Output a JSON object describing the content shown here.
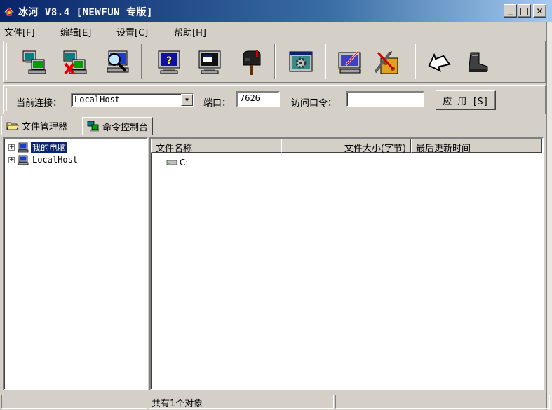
{
  "window": {
    "title": "冰河 V8.4 [NEWFUN 专版]",
    "minimize_symbol": "_",
    "restore_symbol": "□",
    "close_symbol": "✕"
  },
  "menu": {
    "items": [
      "文件[F]",
      "编辑[E]",
      "设置[C]",
      "帮助[H]"
    ]
  },
  "toolbar": {
    "buttons": [
      "add-host-icon",
      "delete-host-icon",
      "search-host-icon",
      "help-monitor-icon",
      "screen-capture-icon",
      "mailbox-icon",
      "gear-window-icon",
      "config-icon",
      "tools-icon",
      "back-arrow-icon",
      "exit-boot-icon"
    ]
  },
  "connection": {
    "current_label": "当前连接：",
    "current_value": "LocalHost",
    "port_label": "端口：",
    "port_value": "7626",
    "password_label": "访问口令：",
    "password_value": "",
    "apply_label": "应 用 [S]"
  },
  "tabs": {
    "file_manager": "文件管理器",
    "command_console": "命令控制台"
  },
  "tree": {
    "nodes": [
      {
        "label": "我的电脑",
        "selected": true
      },
      {
        "label": "LocalHost",
        "selected": false
      }
    ]
  },
  "file_list": {
    "columns": [
      "文件名称",
      "文件大小(字节)",
      "最后更新时间"
    ],
    "rows": [
      {
        "name": "C:",
        "icon": "drive-icon"
      }
    ]
  },
  "status": {
    "text": "共有1个对象"
  },
  "colors": {
    "face": "#d4d0c8",
    "title_start": "#0a246a",
    "title_end": "#a6caf0",
    "selection": "#0a246a"
  }
}
